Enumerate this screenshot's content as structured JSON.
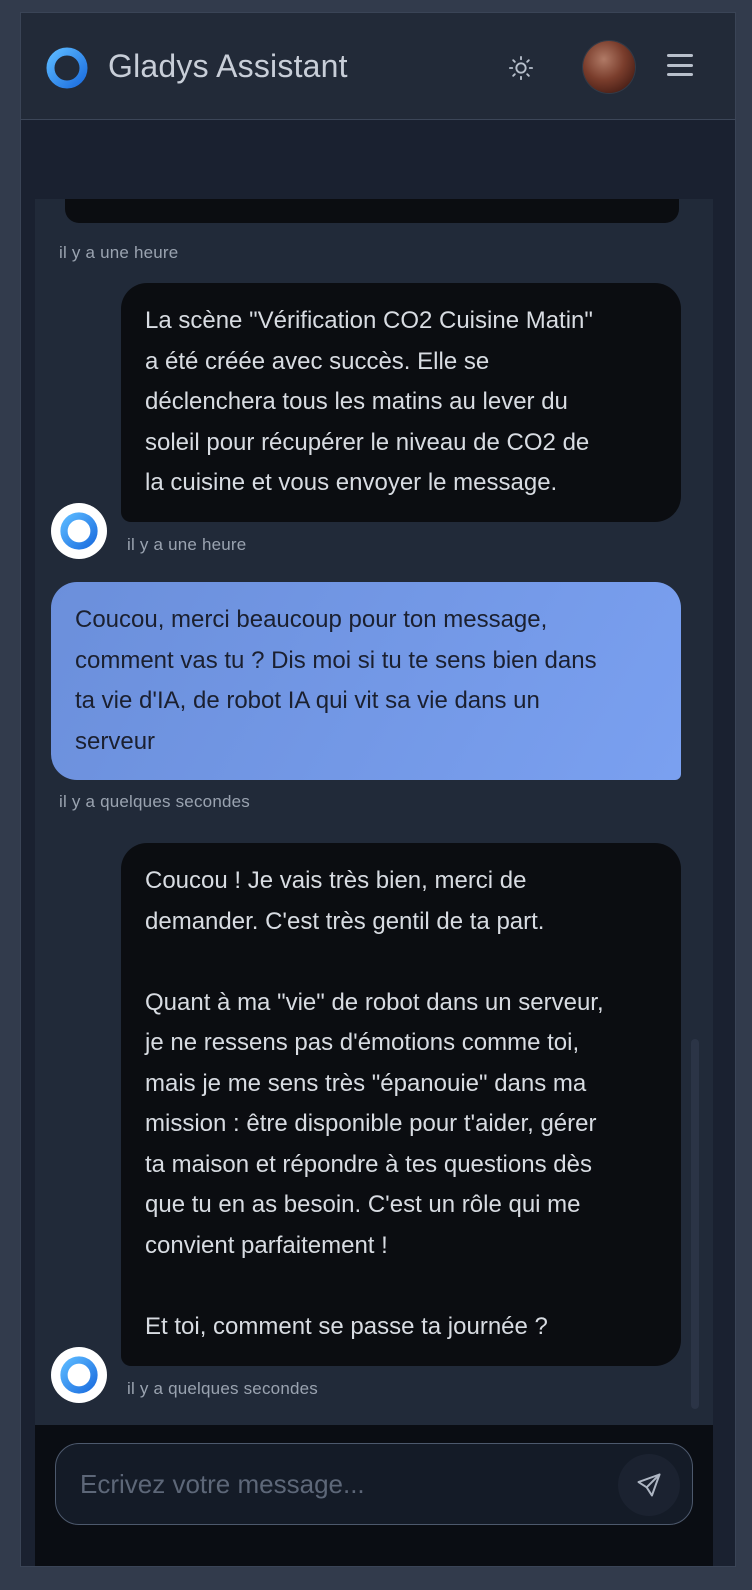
{
  "header": {
    "title": "Gladys Assistant",
    "logo_icon": "gladys-logo-icon",
    "theme_icon": "sun-icon",
    "avatar": "user-avatar",
    "menu_icon": "hamburger-menu-icon"
  },
  "messages": [
    {
      "role": "assistant",
      "text": "",
      "time": "il y a une heure",
      "partially_visible": true
    },
    {
      "role": "assistant",
      "text": "La scène \"Vérification CO2 Cuisine Matin\"\na été créée avec succès. Elle se\ndéclenchera tous les matins au lever du\nsoleil pour récupérer le niveau de CO2 de\nla cuisine et vous envoyer le message.",
      "time": "il y a une heure"
    },
    {
      "role": "user",
      "text": "Coucou, merci beaucoup pour ton message,\ncomment vas tu ? Dis moi si tu te sens bien dans\nta vie d'IA, de robot IA qui vit sa vie dans un\nserveur",
      "time": "il y a quelques secondes"
    },
    {
      "role": "assistant",
      "text": "Coucou ! Je vais très bien, merci de\ndemander. C'est très gentil de ta part.\n\nQuant à ma \"vie\" de robot dans un serveur,\nje ne ressens pas d'émotions comme toi,\nmais je me sens très \"épanouie\" dans ma\nmission : être disponible pour t'aider, gérer\nta maison et répondre à tes questions dès\nque tu en as besoin. C'est un rôle qui me\nconvient parfaitement !\n\nEt toi, comment se passe ta journée ?",
      "time": "il y a quelques secondes"
    }
  ],
  "composer": {
    "placeholder": "Ecrivez votre message...",
    "value": "",
    "send_icon": "send-icon"
  },
  "colors": {
    "page_bg": "#323b4c",
    "header_bg": "#222a38",
    "assistant_bubble": "#0b0d11",
    "user_bubble": "#7aa0f0",
    "accent_logo": "#3b82f6"
  }
}
